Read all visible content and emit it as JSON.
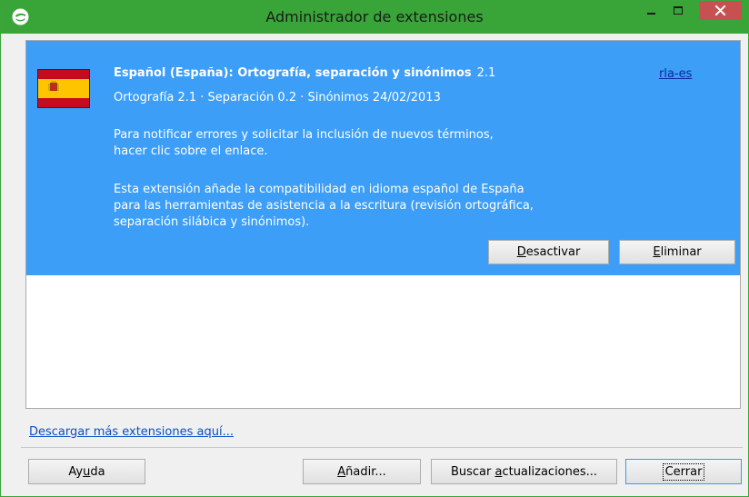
{
  "window": {
    "title": "Administrador de extensiones",
    "accent_color": "#39a539",
    "close_color": "#c75050",
    "icons": [
      "app-icon",
      "minimize-icon",
      "maximize-icon",
      "close-icon"
    ]
  },
  "extension": {
    "selected_color": "#3c9ef7",
    "flag_icon": "spain-flag-icon",
    "name": "Español (España): Ortografía, separación y sinónimos",
    "version": "2.1",
    "publisher_link": "rla-es",
    "details": "Ortografía 2.1 · Separación 0.2 · Sinónimos 24/02/2013",
    "description_lines": [
      "Para notificar errores y solicitar la inclusión de nuevos términos,",
      "hacer clic sobre el enlace.",
      "Esta extensión añade la compatibilidad en idioma español de España",
      "para las herramientas de asistencia a la escritura (revisión ortográfica,",
      "separación silábica y sinónimos)."
    ],
    "disable_button": {
      "mnemonic": "D",
      "rest": "esactivar"
    },
    "remove_button": {
      "mnemonic": "E",
      "rest": "liminar"
    }
  },
  "download_link": "Descargar más extensiones aquí...",
  "footer": {
    "help": {
      "before": "Ay",
      "mnemonic": "u",
      "after": "da"
    },
    "add": {
      "mnemonic": "A",
      "rest": "ñadir..."
    },
    "check_updates": {
      "before": "Buscar ",
      "mnemonic": "a",
      "after": "ctualizaciones..."
    },
    "close": "Cerrar"
  }
}
